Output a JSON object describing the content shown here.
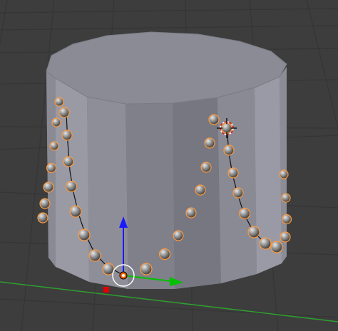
{
  "viewport": {
    "type": "3d-viewport",
    "background": "#3d3d3d",
    "grid_color": "#353535",
    "x_axis_color": "#33b033",
    "object_color": "#8e8e98"
  },
  "gizmo": {
    "z_arrow_color": "#1a1aff",
    "y_arrow_color": "#00c000",
    "origin_color": "#ff6600"
  },
  "cursor_3d": {
    "icon": "3d-cursor-icon"
  },
  "selection_highlight": "#ff9a3c"
}
